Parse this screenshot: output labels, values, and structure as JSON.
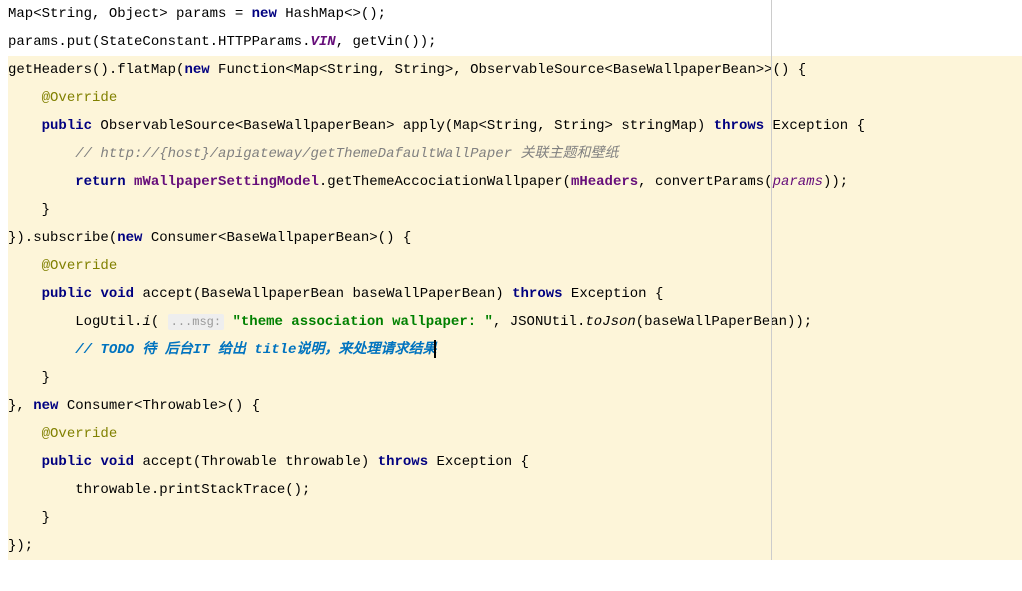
{
  "code": {
    "line1": {
      "text1": "Map<String, Object> params = ",
      "kw_new": "new",
      "text2": " HashMap<>();"
    },
    "line2": {
      "text1": "params.put(",
      "cls1": "StateConstant",
      "dot1": ".",
      "cls2": "HTTPParams",
      "dot2": ".",
      "constant": "VIN",
      "text2": ", getVin());"
    },
    "line3": {
      "text1": "getHeaders().flatMap(",
      "kw_new": "new",
      "text2": " Function<Map<String, String>, ObservableSource<BaseWallpaperBean>>() {"
    },
    "line4": {
      "indent": "    ",
      "annotation": "@Override"
    },
    "line5": {
      "indent": "    ",
      "kw_public": "public",
      "text1": " ObservableSource<BaseWallpaperBean> apply(Map<String, String> stringMap) ",
      "kw_throws": "throws",
      "text2": " Exception {"
    },
    "line6": {
      "indent": "        ",
      "comment": "// http://{host}/apigateway/getThemeDafaultWallPaper 关联主题和壁纸"
    },
    "line7": {
      "indent": "        ",
      "kw_return": "return",
      "text1": " ",
      "field1": "mWallpaperSettingModel",
      "text2": ".getThemeAccociationWallpaper(",
      "field2": "mHeaders",
      "text3": ", convertParams(",
      "param": "params",
      "text4": "));"
    },
    "line8": {
      "indent": "    ",
      "text": "}"
    },
    "line9": {
      "text1": "}).subscribe(",
      "kw_new": "new",
      "text2": " Consumer<BaseWallpaperBean>() {"
    },
    "line10": {
      "indent": "    ",
      "annotation": "@Override"
    },
    "line11": {
      "indent": "    ",
      "kw_public": "public",
      "text1": " ",
      "kw_void": "void",
      "text2": " accept(BaseWallpaperBean baseWallPaperBean) ",
      "kw_throws": "throws",
      "text3": " Exception {"
    },
    "line12": {
      "indent": "        ",
      "text1": "LogUtil.",
      "method": "i",
      "text2": "( ",
      "hint": "...msg:",
      "text3": " ",
      "string": "\"theme association wallpaper: \"",
      "text4": ", JSONUtil.",
      "method2": "toJson",
      "text5": "(baseWallPaperBean));"
    },
    "line13": {
      "indent": "        ",
      "todo": "// TODO 待 后台IT 给出 title说明，来处理请求结果"
    },
    "line14": {
      "indent": "    ",
      "text": "}"
    },
    "line15": {
      "text1": "}, ",
      "kw_new": "new",
      "text2": " Consumer<Throwable>() {"
    },
    "line16": {
      "indent": "    ",
      "annotation": "@Override"
    },
    "line17": {
      "indent": "    ",
      "kw_public": "public",
      "text1": " ",
      "kw_void": "void",
      "text2": " accept(Throwable throwable) ",
      "kw_throws": "throws",
      "text3": " Exception {"
    },
    "line18": {
      "indent": "        ",
      "text": "throwable.printStackTrace();"
    },
    "line19": {
      "indent": "    ",
      "text": "}"
    },
    "line20": {
      "text": "});"
    }
  }
}
